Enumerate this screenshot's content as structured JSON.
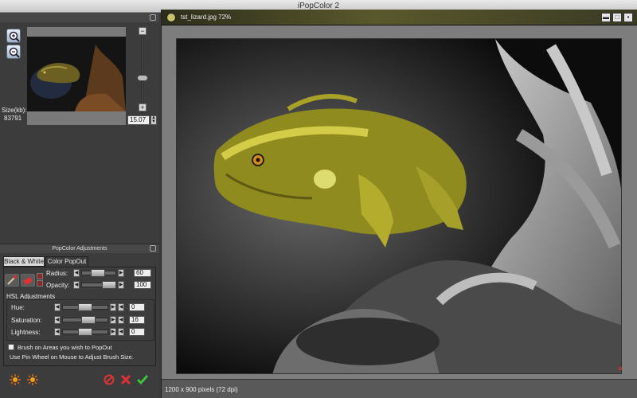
{
  "window": {
    "title": "iPopColor 2"
  },
  "preview": {
    "zoom_in": "zoom-in-icon",
    "zoom_out": "zoom-out-icon",
    "size_label": "Size(kb):",
    "size_value": "83791",
    "zoom_value": "15.07"
  },
  "adjustments": {
    "header": "PopColor Adjustments",
    "tabs": [
      "Black & White",
      "Color PopOut"
    ],
    "radius_label": "Radius:",
    "radius_value": "60",
    "opacity_label": "Opacity:",
    "opacity_value": "100",
    "hsl_title": "HSL Adjustments",
    "hue_label": "Hue:",
    "hue_value": "0",
    "saturation_label": "Saturation:",
    "saturation_value": "16",
    "lightness_label": "Lightness:",
    "lightness_value": "0",
    "brush_label": "Brush on Areas you wish to PopOut",
    "pinwheel_label": "Use Pin Wheel on Mouse to Adjust Brush Size."
  },
  "image_window": {
    "title": "tst_lizard.jpg 72%",
    "status": "1200 x 900 pixels (72 dpi)"
  },
  "colors": {
    "accent_olive": "#59582c",
    "lizard_yellow": "#b8b42a",
    "panel_dark": "#3c3c3c"
  }
}
